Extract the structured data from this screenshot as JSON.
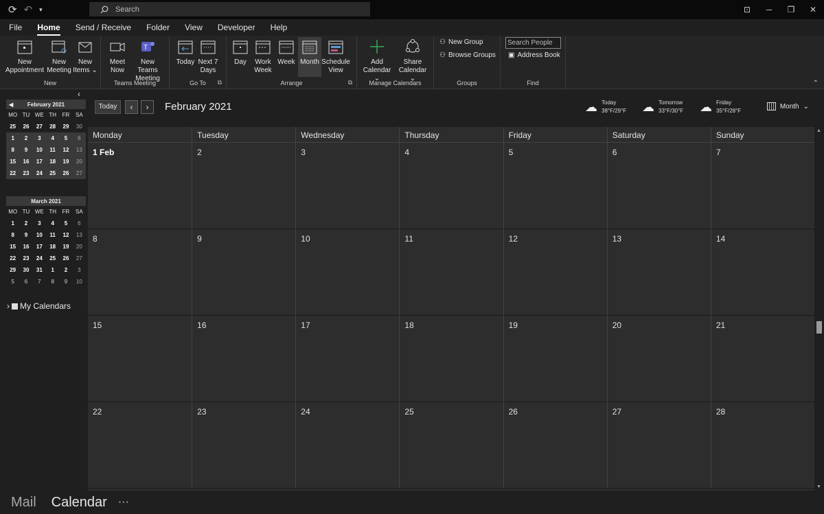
{
  "titlebar": {
    "search_placeholder": "Search",
    "qat_icons": [
      "sync-icon",
      "undo-icon",
      "customize-icon"
    ]
  },
  "menu": {
    "items": [
      "File",
      "Home",
      "Send / Receive",
      "Folder",
      "View",
      "Developer",
      "Help"
    ],
    "active": "Home"
  },
  "ribbon": {
    "groups": {
      "new": "New",
      "teams": "Teams Meeting",
      "goto": "Go To",
      "arrange": "Arrange",
      "manage": "Manage Calendars",
      "groups": "Groups",
      "find": "Find"
    },
    "buttons": {
      "new_appointment": [
        "New",
        "Appointment"
      ],
      "new_meeting": [
        "New",
        "Meeting"
      ],
      "new_items": [
        "New",
        "Items ⌄"
      ],
      "meet_now": [
        "Meet",
        "Now"
      ],
      "new_teams_meeting": [
        "New Teams",
        "Meeting"
      ],
      "today": [
        "Today",
        ""
      ],
      "next7": [
        "Next 7",
        "Days"
      ],
      "day": [
        "Day",
        ""
      ],
      "work_week": [
        "Work",
        "Week"
      ],
      "week": [
        "Week",
        ""
      ],
      "month": [
        "Month",
        ""
      ],
      "schedule_view": [
        "Schedule",
        "View"
      ],
      "add_calendar": [
        "Add",
        "Calendar ⌄"
      ],
      "share_calendar": [
        "Share",
        "Calendar ⌄"
      ],
      "new_group": "New Group",
      "browse_groups": "Browse Groups",
      "search_people": "Search People",
      "address_book": "Address Book"
    }
  },
  "minical": {
    "day_headers": [
      "MO",
      "TU",
      "WE",
      "TH",
      "FR",
      "SA"
    ],
    "feb": {
      "title": "February 2021",
      "weeks": [
        [
          "25",
          "26",
          "27",
          "28",
          "29",
          "30"
        ],
        [
          "1",
          "2",
          "3",
          "4",
          "5",
          "6"
        ],
        [
          "8",
          "9",
          "10",
          "11",
          "12",
          "13"
        ],
        [
          "15",
          "16",
          "17",
          "18",
          "19",
          "20"
        ],
        [
          "22",
          "23",
          "24",
          "25",
          "26",
          "27"
        ]
      ]
    },
    "mar": {
      "title": "March 2021",
      "weeks": [
        [
          "1",
          "2",
          "3",
          "4",
          "5",
          "6"
        ],
        [
          "8",
          "9",
          "10",
          "11",
          "12",
          "13"
        ],
        [
          "15",
          "16",
          "17",
          "18",
          "19",
          "20"
        ],
        [
          "22",
          "23",
          "24",
          "25",
          "26",
          "27"
        ],
        [
          "29",
          "30",
          "31",
          "1",
          "2",
          "3"
        ],
        [
          "5",
          "6",
          "7",
          "8",
          "9",
          "10"
        ]
      ]
    },
    "my_calendars": "My Calendars"
  },
  "calendar": {
    "today_button": "Today",
    "title": "February 2021",
    "weather": [
      {
        "label": "Today",
        "temp": "38°F/29°F"
      },
      {
        "label": "Tomorrow",
        "temp": "33°F/30°F"
      },
      {
        "label": "Friday",
        "temp": "35°F/28°F"
      }
    ],
    "view_selector": "Month",
    "day_names": [
      "Monday",
      "Tuesday",
      "Wednesday",
      "Thursday",
      "Friday",
      "Saturday",
      "Sunday"
    ],
    "weeks": [
      [
        "1 Feb",
        "2",
        "3",
        "4",
        "5",
        "6",
        "7"
      ],
      [
        "8",
        "9",
        "10",
        "11",
        "12",
        "13",
        "14"
      ],
      [
        "15",
        "16",
        "17",
        "18",
        "19",
        "20",
        "21"
      ],
      [
        "22",
        "23",
        "24",
        "25",
        "26",
        "27",
        "28"
      ]
    ]
  },
  "bottomnav": {
    "mail": "Mail",
    "calendar": "Calendar",
    "more": "···"
  }
}
